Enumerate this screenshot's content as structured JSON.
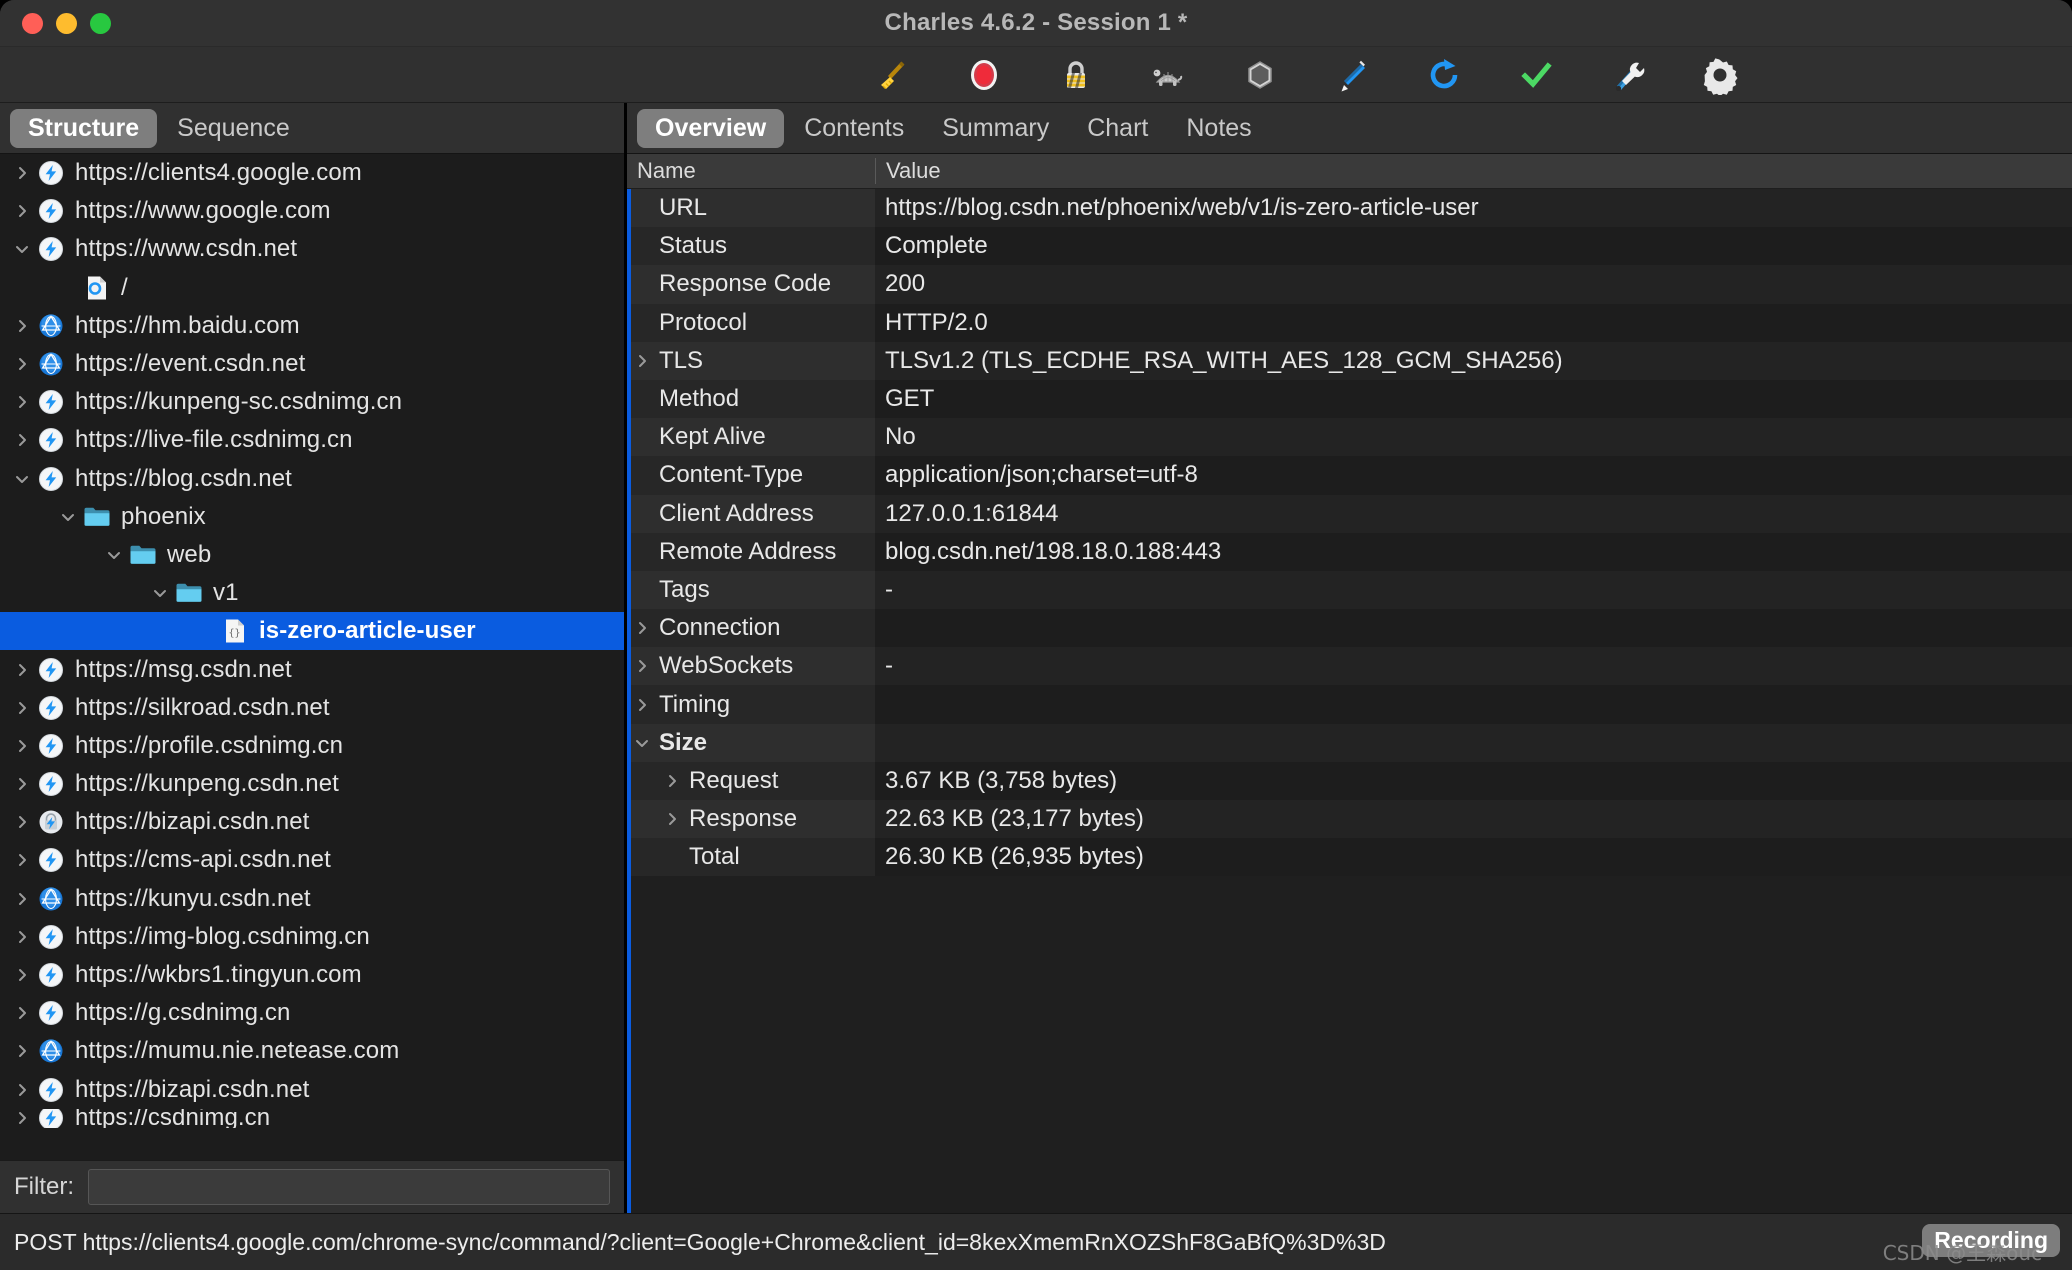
{
  "window": {
    "title": "Charles 4.6.2 - Session 1 *",
    "traffic_lights": [
      "close",
      "minimize",
      "zoom"
    ]
  },
  "toolbar": {
    "buttons": [
      {
        "name": "clear-session",
        "icon": "broom-icon"
      },
      {
        "name": "start-stop-recording",
        "icon": "record-icon"
      },
      {
        "name": "ssl-proxying",
        "icon": "lock-icon"
      },
      {
        "name": "throttling",
        "icon": "turtle-icon"
      },
      {
        "name": "breakpoints",
        "icon": "hexagon-icon"
      },
      {
        "name": "compose",
        "icon": "pen-icon"
      },
      {
        "name": "repeat",
        "icon": "repeat-icon"
      },
      {
        "name": "validate",
        "icon": "checkmark-icon"
      },
      {
        "name": "tools",
        "icon": "tools-icon"
      },
      {
        "name": "settings",
        "icon": "gear-icon"
      }
    ]
  },
  "left_panel": {
    "tabs": [
      {
        "label": "Structure",
        "active": true
      },
      {
        "label": "Sequence",
        "active": false
      }
    ],
    "tree": [
      {
        "label": "https://clients4.google.com",
        "indent": 0,
        "twisty": "right",
        "icon": "https-bolt-icon",
        "selected": false
      },
      {
        "label": "https://www.google.com",
        "indent": 0,
        "twisty": "right",
        "icon": "https-bolt-icon",
        "selected": false
      },
      {
        "label": "https://www.csdn.net",
        "indent": 0,
        "twisty": "down",
        "icon": "https-bolt-icon",
        "selected": false
      },
      {
        "label": "/",
        "indent": 1,
        "twisty": "none",
        "icon": "document-icon",
        "selected": false
      },
      {
        "label": "https://hm.baidu.com",
        "indent": 0,
        "twisty": "right",
        "icon": "globe-icon",
        "selected": false
      },
      {
        "label": "https://event.csdn.net",
        "indent": 0,
        "twisty": "right",
        "icon": "globe-icon",
        "selected": false
      },
      {
        "label": "https://kunpeng-sc.csdnimg.cn",
        "indent": 0,
        "twisty": "right",
        "icon": "https-bolt-icon",
        "selected": false
      },
      {
        "label": "https://live-file.csdnimg.cn",
        "indent": 0,
        "twisty": "right",
        "icon": "https-bolt-icon",
        "selected": false
      },
      {
        "label": "https://blog.csdn.net",
        "indent": 0,
        "twisty": "down",
        "icon": "https-bolt-icon",
        "selected": false
      },
      {
        "label": "phoenix",
        "indent": 1,
        "twisty": "down",
        "icon": "folder-icon",
        "selected": false
      },
      {
        "label": "web",
        "indent": 2,
        "twisty": "down",
        "icon": "folder-icon",
        "selected": false
      },
      {
        "label": "v1",
        "indent": 3,
        "twisty": "down",
        "icon": "folder-icon",
        "selected": false
      },
      {
        "label": "is-zero-article-user",
        "indent": 4,
        "twisty": "none",
        "icon": "json-file-icon",
        "selected": true
      },
      {
        "label": "https://msg.csdn.net",
        "indent": 0,
        "twisty": "right",
        "icon": "https-bolt-icon",
        "selected": false
      },
      {
        "label": "https://silkroad.csdn.net",
        "indent": 0,
        "twisty": "right",
        "icon": "https-bolt-icon",
        "selected": false
      },
      {
        "label": "https://profile.csdnimg.cn",
        "indent": 0,
        "twisty": "right",
        "icon": "https-bolt-icon",
        "selected": false
      },
      {
        "label": "https://kunpeng.csdn.net",
        "indent": 0,
        "twisty": "right",
        "icon": "https-bolt-icon",
        "selected": false
      },
      {
        "label": "https://bizapi.csdn.net",
        "indent": 0,
        "twisty": "right",
        "icon": "https-locked-bolt-icon",
        "selected": false
      },
      {
        "label": "https://cms-api.csdn.net",
        "indent": 0,
        "twisty": "right",
        "icon": "https-bolt-icon",
        "selected": false
      },
      {
        "label": "https://kunyu.csdn.net",
        "indent": 0,
        "twisty": "right",
        "icon": "globe-icon",
        "selected": false
      },
      {
        "label": "https://img-blog.csdnimg.cn",
        "indent": 0,
        "twisty": "right",
        "icon": "https-bolt-icon",
        "selected": false
      },
      {
        "label": "https://wkbrs1.tingyun.com",
        "indent": 0,
        "twisty": "right",
        "icon": "https-bolt-icon",
        "selected": false
      },
      {
        "label": "https://g.csdnimg.cn",
        "indent": 0,
        "twisty": "right",
        "icon": "https-bolt-icon",
        "selected": false
      },
      {
        "label": "https://mumu.nie.netease.com",
        "indent": 0,
        "twisty": "right",
        "icon": "globe-icon",
        "selected": false
      },
      {
        "label": "https://bizapi.csdn.net",
        "indent": 0,
        "twisty": "right",
        "icon": "https-bolt-icon",
        "selected": false
      },
      {
        "label": "https://csdnimg.cn",
        "indent": 0,
        "twisty": "right",
        "icon": "https-bolt-icon",
        "selected": false
      }
    ],
    "filter": {
      "label": "Filter:",
      "value": "",
      "placeholder": ""
    }
  },
  "right_panel": {
    "tabs": [
      {
        "label": "Overview",
        "active": true
      },
      {
        "label": "Contents",
        "active": false
      },
      {
        "label": "Summary",
        "active": false
      },
      {
        "label": "Chart",
        "active": false
      },
      {
        "label": "Notes",
        "active": false
      }
    ],
    "columns": {
      "name": "Name",
      "value": "Value"
    },
    "rows": [
      {
        "name": "URL",
        "value": "https://blog.csdn.net/phoenix/web/v1/is-zero-article-user",
        "twisty": "none",
        "indent": 0,
        "bold": false
      },
      {
        "name": "Status",
        "value": "Complete",
        "twisty": "none",
        "indent": 0,
        "bold": false
      },
      {
        "name": "Response Code",
        "value": "200",
        "twisty": "none",
        "indent": 0,
        "bold": false
      },
      {
        "name": "Protocol",
        "value": "HTTP/2.0",
        "twisty": "none",
        "indent": 0,
        "bold": false
      },
      {
        "name": "TLS",
        "value": "TLSv1.2 (TLS_ECDHE_RSA_WITH_AES_128_GCM_SHA256)",
        "twisty": "right",
        "indent": 0,
        "bold": false
      },
      {
        "name": "Method",
        "value": "GET",
        "twisty": "none",
        "indent": 0,
        "bold": false
      },
      {
        "name": "Kept Alive",
        "value": "No",
        "twisty": "none",
        "indent": 0,
        "bold": false
      },
      {
        "name": "Content-Type",
        "value": "application/json;charset=utf-8",
        "twisty": "none",
        "indent": 0,
        "bold": false
      },
      {
        "name": "Client Address",
        "value": "127.0.0.1:61844",
        "twisty": "none",
        "indent": 0,
        "bold": false
      },
      {
        "name": "Remote Address",
        "value": "blog.csdn.net/198.18.0.188:443",
        "twisty": "none",
        "indent": 0,
        "bold": false
      },
      {
        "name": "Tags",
        "value": "-",
        "twisty": "none",
        "indent": 0,
        "bold": false
      },
      {
        "name": "Connection",
        "value": "",
        "twisty": "right",
        "indent": 0,
        "bold": false
      },
      {
        "name": "WebSockets",
        "value": "-",
        "twisty": "right",
        "indent": 0,
        "bold": false
      },
      {
        "name": "Timing",
        "value": "",
        "twisty": "right",
        "indent": 0,
        "bold": false
      },
      {
        "name": "Size",
        "value": "",
        "twisty": "down",
        "indent": 0,
        "bold": true
      },
      {
        "name": "Request",
        "value": "3.67 KB (3,758 bytes)",
        "twisty": "right",
        "indent": 1,
        "bold": false
      },
      {
        "name": "Response",
        "value": "22.63 KB (23,177 bytes)",
        "twisty": "right",
        "indent": 1,
        "bold": false
      },
      {
        "name": "Total",
        "value": "26.30 KB (26,935 bytes)",
        "twisty": "none",
        "indent": 1,
        "bold": false
      }
    ]
  },
  "status_bar": {
    "text": "POST https://clients4.google.com/chrome-sync/command/?client=Google+Chrome&client_id=8kexXmemRnXOZShF8GaBfQ%3D%3D",
    "recording_badge": "Recording",
    "watermark": "CSDN @王森ouc"
  },
  "colors": {
    "selection_blue": "#0a5ce0",
    "accent_blue": "#2196f3",
    "record_red": "#ef2b3a",
    "check_green": "#4cd964",
    "folder_blue": "#5ec8f0"
  }
}
